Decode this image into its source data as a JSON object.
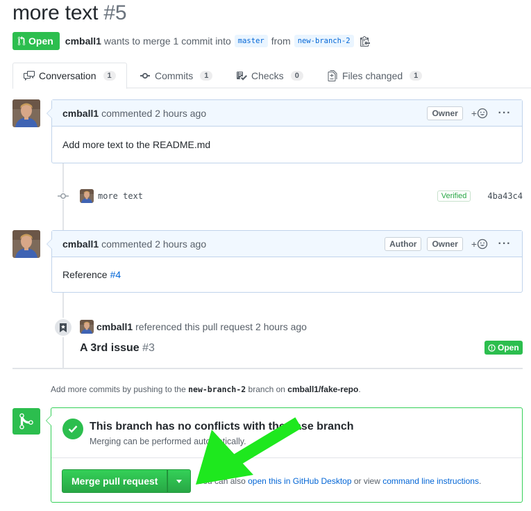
{
  "pr": {
    "title": "more text",
    "number": "#5",
    "state": "Open",
    "author": "cmball1",
    "merge_text": "wants to merge 1 commit into",
    "base_branch": "master",
    "from_text": "from",
    "head_branch": "new-branch-2"
  },
  "tabs": [
    {
      "label": "Conversation",
      "count": "1",
      "icon": "comment-discussion-icon"
    },
    {
      "label": "Commits",
      "count": "1",
      "icon": "git-commit-icon"
    },
    {
      "label": "Checks",
      "count": "0",
      "icon": "checklist-icon"
    },
    {
      "label": "Files changed",
      "count": "1",
      "icon": "file-diff-icon"
    }
  ],
  "comment1": {
    "author": "cmball1",
    "action": "commented",
    "time": "2 hours ago",
    "owner_label": "Owner",
    "body": "Add more text to the README.md"
  },
  "commit": {
    "message": "more text",
    "verified": "Verified",
    "sha": "4ba43c4"
  },
  "comment2": {
    "author": "cmball1",
    "action": "commented",
    "time": "2 hours ago",
    "author_label": "Author",
    "owner_label": "Owner",
    "body_text": "Reference",
    "body_link": "#4"
  },
  "reference": {
    "actor": "cmball1",
    "text": "referenced this pull request",
    "time": "2 hours ago",
    "issue_title": "A 3rd issue",
    "issue_number": "#3",
    "issue_state": "Open"
  },
  "hint": {
    "prefix": "Add more commits by pushing to the",
    "branch": "new-branch-2",
    "middle": "branch on",
    "repo": "cmball1/fake-repo",
    "suffix": "."
  },
  "merge": {
    "heading": "This branch has no conflicts with the base branch",
    "sub": "Merging can be performed automatically.",
    "button": "Merge pull request",
    "note_prefix": "You can also",
    "note_link1": "open this in GitHub Desktop",
    "note_middle": "or view",
    "note_link2": "command line instructions",
    "note_suffix": "."
  },
  "colors": {
    "open_green": "#2cbe4e",
    "link_blue": "#0366d6",
    "annotation_arrow": "#1ee81e"
  }
}
